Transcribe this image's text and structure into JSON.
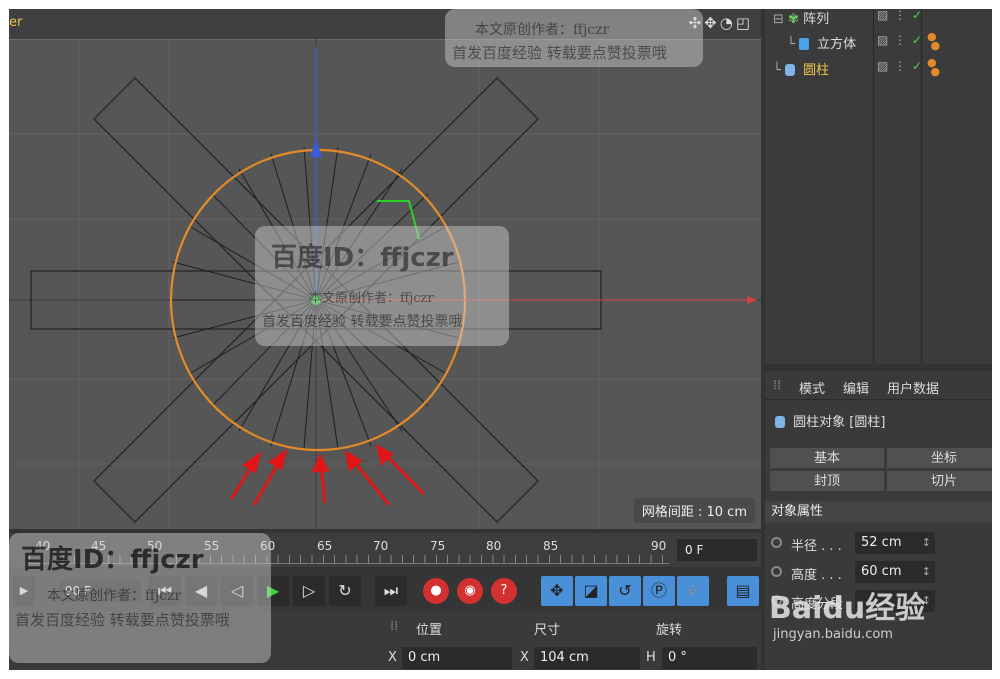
{
  "viewport": {
    "title": "er",
    "header_icons": "✣✥◔◰",
    "grid_spacing": "网格间距 : 10 cm"
  },
  "object_manager": {
    "items": [
      {
        "name": "阵列",
        "color": "#6fd16f"
      },
      {
        "name": "立方体",
        "color": "#4aa3e8"
      },
      {
        "name": "圆柱",
        "color": "#f0c64a"
      }
    ]
  },
  "attributes": {
    "menu": [
      "模式",
      "编辑",
      "用户数据"
    ],
    "object_label": "圆柱对象 [圆柱]",
    "tabs": [
      "基本",
      "坐标",
      "封顶",
      "切片"
    ],
    "section": "对象属性",
    "props": [
      {
        "label": "半径 . . .",
        "value": "52 cm"
      },
      {
        "label": "高度 . . .",
        "value": "60 cm"
      },
      {
        "label": "高度分段",
        "value": ""
      }
    ]
  },
  "timeline": {
    "ticks": [
      "40",
      "45",
      "50",
      "55",
      "60",
      "65",
      "70",
      "75",
      "80",
      "85",
      "90"
    ],
    "current_frame": "0 F",
    "transport_frame": "90 F"
  },
  "coordinates": {
    "headers": [
      "位置",
      "尺寸",
      "旋转"
    ],
    "row": [
      {
        "axis": "X",
        "value": "0 cm"
      },
      {
        "axis": "X",
        "value": "104 cm"
      },
      {
        "axis": "H",
        "value": "0 °"
      }
    ]
  },
  "watermarks": {
    "top_line1": "本文原创作者：ffjczr",
    "top_line2": "首发百度经验 转载要点赞投票哦",
    "center_id": "百度ID：ffjczr",
    "center_line1": "本文原创作者：ffjczr",
    "center_line2": "首发百度经验 转载要点赞投票哦",
    "bottom_id": "百度ID：ffjczr",
    "bottom_line1": "本文原创作者：ffjczr",
    "bottom_line2": "首发百度经验 转载要点赞投票哦",
    "logo": "Baidu经验",
    "logo_url": "jingyan.baidu.com"
  },
  "colors": {
    "accent_orange": "#e38b2a",
    "axis_x": "#d94040",
    "axis_y": "#3a5bd8",
    "arrows": "#e01515"
  }
}
